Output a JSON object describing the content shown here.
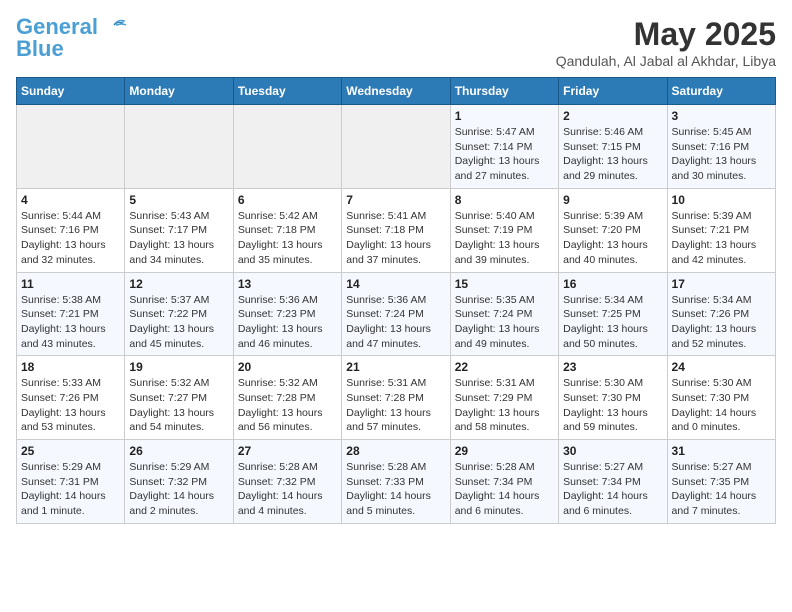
{
  "header": {
    "logo_line1": "General",
    "logo_line2": "Blue",
    "month_year": "May 2025",
    "location": "Qandulah, Al Jabal al Akhdar, Libya"
  },
  "weekdays": [
    "Sunday",
    "Monday",
    "Tuesday",
    "Wednesday",
    "Thursday",
    "Friday",
    "Saturday"
  ],
  "weeks": [
    [
      {
        "day": "",
        "info": ""
      },
      {
        "day": "",
        "info": ""
      },
      {
        "day": "",
        "info": ""
      },
      {
        "day": "",
        "info": ""
      },
      {
        "day": "1",
        "info": "Sunrise: 5:47 AM\nSunset: 7:14 PM\nDaylight: 13 hours and 27 minutes."
      },
      {
        "day": "2",
        "info": "Sunrise: 5:46 AM\nSunset: 7:15 PM\nDaylight: 13 hours and 29 minutes."
      },
      {
        "day": "3",
        "info": "Sunrise: 5:45 AM\nSunset: 7:16 PM\nDaylight: 13 hours and 30 minutes."
      }
    ],
    [
      {
        "day": "4",
        "info": "Sunrise: 5:44 AM\nSunset: 7:16 PM\nDaylight: 13 hours and 32 minutes."
      },
      {
        "day": "5",
        "info": "Sunrise: 5:43 AM\nSunset: 7:17 PM\nDaylight: 13 hours and 34 minutes."
      },
      {
        "day": "6",
        "info": "Sunrise: 5:42 AM\nSunset: 7:18 PM\nDaylight: 13 hours and 35 minutes."
      },
      {
        "day": "7",
        "info": "Sunrise: 5:41 AM\nSunset: 7:18 PM\nDaylight: 13 hours and 37 minutes."
      },
      {
        "day": "8",
        "info": "Sunrise: 5:40 AM\nSunset: 7:19 PM\nDaylight: 13 hours and 39 minutes."
      },
      {
        "day": "9",
        "info": "Sunrise: 5:39 AM\nSunset: 7:20 PM\nDaylight: 13 hours and 40 minutes."
      },
      {
        "day": "10",
        "info": "Sunrise: 5:39 AM\nSunset: 7:21 PM\nDaylight: 13 hours and 42 minutes."
      }
    ],
    [
      {
        "day": "11",
        "info": "Sunrise: 5:38 AM\nSunset: 7:21 PM\nDaylight: 13 hours and 43 minutes."
      },
      {
        "day": "12",
        "info": "Sunrise: 5:37 AM\nSunset: 7:22 PM\nDaylight: 13 hours and 45 minutes."
      },
      {
        "day": "13",
        "info": "Sunrise: 5:36 AM\nSunset: 7:23 PM\nDaylight: 13 hours and 46 minutes."
      },
      {
        "day": "14",
        "info": "Sunrise: 5:36 AM\nSunset: 7:24 PM\nDaylight: 13 hours and 47 minutes."
      },
      {
        "day": "15",
        "info": "Sunrise: 5:35 AM\nSunset: 7:24 PM\nDaylight: 13 hours and 49 minutes."
      },
      {
        "day": "16",
        "info": "Sunrise: 5:34 AM\nSunset: 7:25 PM\nDaylight: 13 hours and 50 minutes."
      },
      {
        "day": "17",
        "info": "Sunrise: 5:34 AM\nSunset: 7:26 PM\nDaylight: 13 hours and 52 minutes."
      }
    ],
    [
      {
        "day": "18",
        "info": "Sunrise: 5:33 AM\nSunset: 7:26 PM\nDaylight: 13 hours and 53 minutes."
      },
      {
        "day": "19",
        "info": "Sunrise: 5:32 AM\nSunset: 7:27 PM\nDaylight: 13 hours and 54 minutes."
      },
      {
        "day": "20",
        "info": "Sunrise: 5:32 AM\nSunset: 7:28 PM\nDaylight: 13 hours and 56 minutes."
      },
      {
        "day": "21",
        "info": "Sunrise: 5:31 AM\nSunset: 7:28 PM\nDaylight: 13 hours and 57 minutes."
      },
      {
        "day": "22",
        "info": "Sunrise: 5:31 AM\nSunset: 7:29 PM\nDaylight: 13 hours and 58 minutes."
      },
      {
        "day": "23",
        "info": "Sunrise: 5:30 AM\nSunset: 7:30 PM\nDaylight: 13 hours and 59 minutes."
      },
      {
        "day": "24",
        "info": "Sunrise: 5:30 AM\nSunset: 7:30 PM\nDaylight: 14 hours and 0 minutes."
      }
    ],
    [
      {
        "day": "25",
        "info": "Sunrise: 5:29 AM\nSunset: 7:31 PM\nDaylight: 14 hours and 1 minute."
      },
      {
        "day": "26",
        "info": "Sunrise: 5:29 AM\nSunset: 7:32 PM\nDaylight: 14 hours and 2 minutes."
      },
      {
        "day": "27",
        "info": "Sunrise: 5:28 AM\nSunset: 7:32 PM\nDaylight: 14 hours and 4 minutes."
      },
      {
        "day": "28",
        "info": "Sunrise: 5:28 AM\nSunset: 7:33 PM\nDaylight: 14 hours and 5 minutes."
      },
      {
        "day": "29",
        "info": "Sunrise: 5:28 AM\nSunset: 7:34 PM\nDaylight: 14 hours and 6 minutes."
      },
      {
        "day": "30",
        "info": "Sunrise: 5:27 AM\nSunset: 7:34 PM\nDaylight: 14 hours and 6 minutes."
      },
      {
        "day": "31",
        "info": "Sunrise: 5:27 AM\nSunset: 7:35 PM\nDaylight: 14 hours and 7 minutes."
      }
    ]
  ]
}
